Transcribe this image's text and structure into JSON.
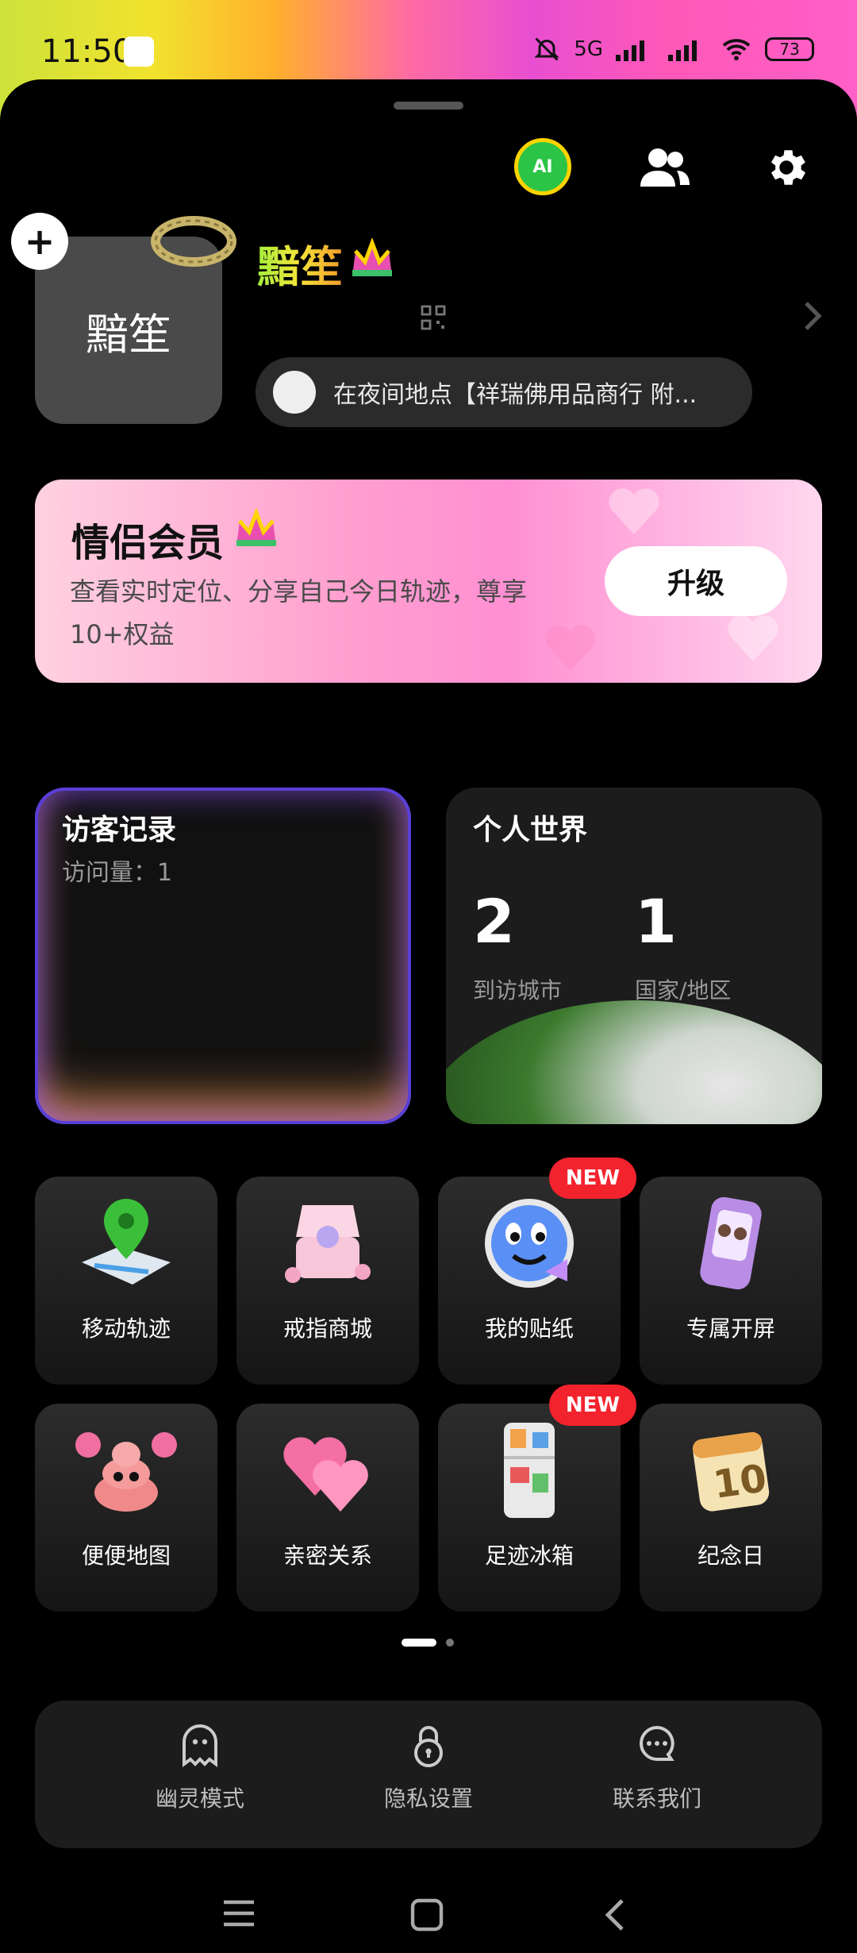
{
  "status": {
    "time": "11:50",
    "battery": "73",
    "network": "5G"
  },
  "profile": {
    "avatar_text": "黯笙",
    "name": "黯笙",
    "location": "在夜间地点【祥瑞佛用品商行 附..."
  },
  "vip": {
    "title": "情侣会员",
    "desc": "查看实时定位、分享自己今日轨迹，尊享10+权益",
    "button": "升级"
  },
  "visitor": {
    "title": "访客记录",
    "count_label": "访问量：1"
  },
  "world": {
    "title": "个人世界",
    "cities": "2",
    "cities_label": "到访城市",
    "countries": "1",
    "countries_label": "国家/地区"
  },
  "tiles": [
    {
      "label": "移动轨迹",
      "new": false
    },
    {
      "label": "戒指商城",
      "new": false
    },
    {
      "label": "我的贴纸",
      "new": true
    },
    {
      "label": "专属开屏",
      "new": false
    },
    {
      "label": "便便地图",
      "new": false
    },
    {
      "label": "亲密关系",
      "new": false
    },
    {
      "label": "足迹冰箱",
      "new": true
    },
    {
      "label": "纪念日",
      "new": false
    }
  ],
  "new_badge": "NEW",
  "bottom": [
    {
      "label": "幽灵模式"
    },
    {
      "label": "隐私设置"
    },
    {
      "label": "联系我们"
    }
  ]
}
